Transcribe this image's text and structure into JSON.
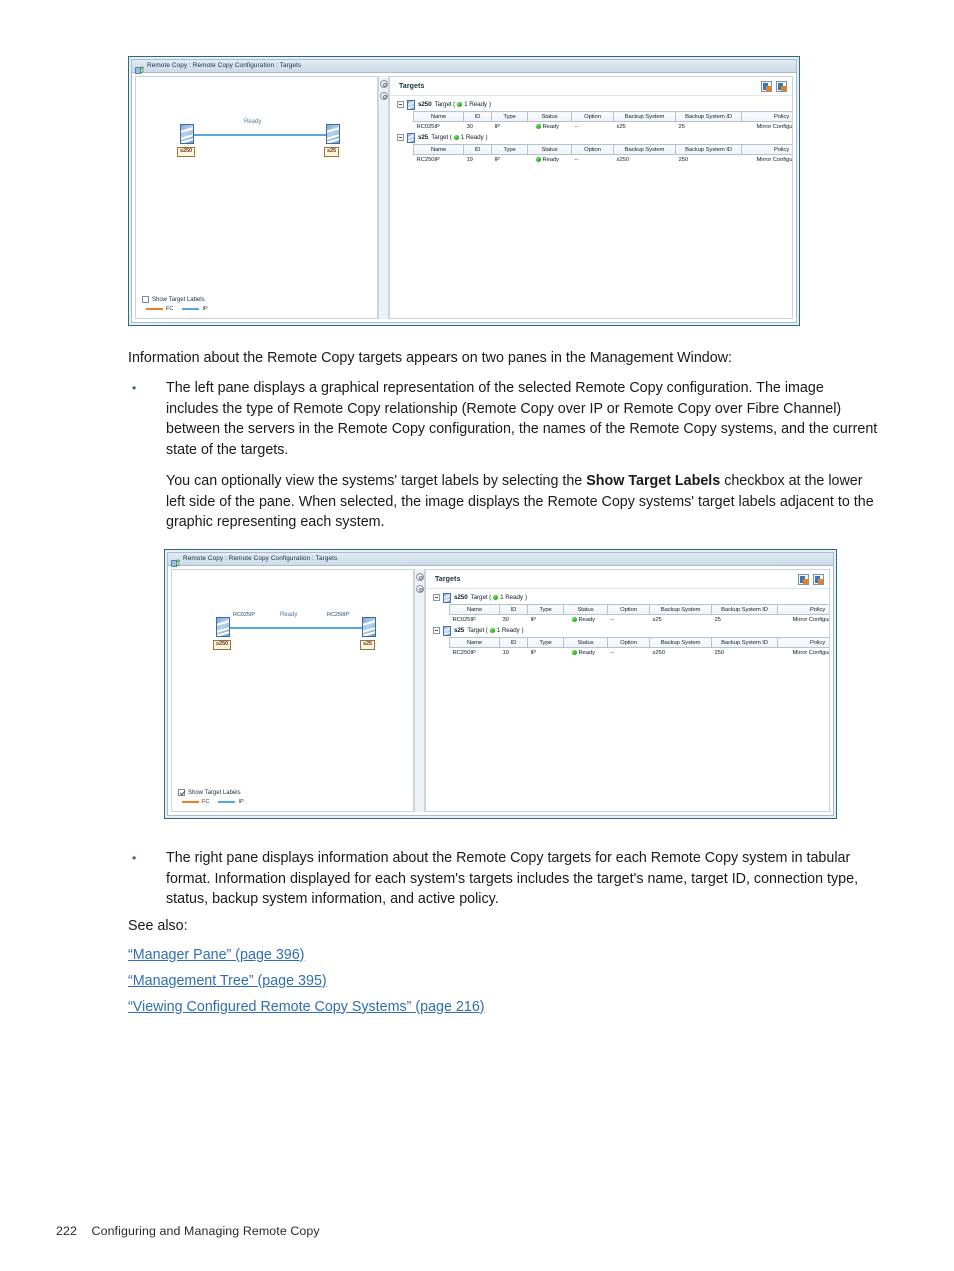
{
  "page": {
    "footer_page_number": "222",
    "footer_title": "Configuring and Managing Remote Copy"
  },
  "screenshot_top": {
    "window_title": "Remote Copy : Remote Copy Configuration : Targets",
    "window_icon": "remote-copy-icon",
    "diagram": {
      "left_system_label": "s250",
      "right_system_label": "s25",
      "link_state": "Ready",
      "link_type": "IP",
      "show_target_labels_checked": false,
      "left_target_label": "",
      "right_target_label": ""
    },
    "legend": {
      "checkbox_label": "Show Target Labels",
      "fc_label": "FC",
      "ip_label": "IP",
      "fc_color": "#ef7d20",
      "ip_color": "#55a7e0"
    },
    "right_pane": {
      "title": "Targets",
      "toolbar_icons": [
        "export-table-icon",
        "print-table-icon"
      ],
      "columns": [
        "Name",
        "ID",
        "Type",
        "Status",
        "Option",
        "Backup System",
        "Backup System ID",
        "Policy"
      ],
      "groups": [
        {
          "system": "s250",
          "node_suffix": "Target (",
          "node_count": "1 Ready",
          "node_suffix_end": ")",
          "rows": [
            {
              "name": "RC025IP",
              "id": "30",
              "type": "IP",
              "status": "Ready",
              "option": "--",
              "backup_system": "s25",
              "backup_system_id": "25",
              "policy": "Mirror Configuration"
            }
          ]
        },
        {
          "system": "s25",
          "node_suffix": "Target (",
          "node_count": "1 Ready",
          "node_suffix_end": ")",
          "rows": [
            {
              "name": "RC250IP",
              "id": "19",
              "type": "IP",
              "status": "Ready",
              "option": "--",
              "backup_system": "s250",
              "backup_system_id": "250",
              "policy": "Mirror Configuration"
            }
          ]
        }
      ]
    }
  },
  "screenshot_bottom": {
    "window_title": "Remote Copy : Remote Copy Configuration : Targets",
    "window_icon": "remote-copy-icon",
    "diagram": {
      "left_system_label": "s250",
      "right_system_label": "s25",
      "link_state": "Ready",
      "link_type": "IP",
      "show_target_labels_checked": true,
      "left_target_label": "RC025IP",
      "right_target_label": "RC250IP"
    },
    "legend": {
      "checkbox_label": "Show Target Labels",
      "fc_label": "FC",
      "ip_label": "IP",
      "fc_color": "#ef7d20",
      "ip_color": "#55a7e0"
    },
    "right_pane": {
      "title": "Targets",
      "toolbar_icons": [
        "export-table-icon",
        "print-table-icon"
      ],
      "columns": [
        "Name",
        "ID",
        "Type",
        "Status",
        "Option",
        "Backup System",
        "Backup System ID",
        "Policy"
      ],
      "groups": [
        {
          "system": "s250",
          "node_suffix": "Target (",
          "node_count": "1 Ready",
          "node_suffix_end": ")",
          "rows": [
            {
              "name": "RC025IP",
              "id": "30",
              "type": "IP",
              "status": "Ready",
              "option": "--",
              "backup_system": "s25",
              "backup_system_id": "25",
              "policy": "Mirror Configuration"
            }
          ]
        },
        {
          "system": "s25",
          "node_suffix": "Target (",
          "node_count": "1 Ready",
          "node_suffix_end": ")",
          "rows": [
            {
              "name": "RC250IP",
              "id": "19",
              "type": "IP",
              "status": "Ready",
              "option": "--",
              "backup_system": "s250",
              "backup_system_id": "250",
              "policy": "Mirror Configuration"
            }
          ]
        }
      ]
    }
  },
  "body": {
    "intro": "Information about the Remote Copy targets appears on two panes in the Management Window:",
    "bullet_marker": "•",
    "bullet1_text": "The left pane displays a graphical representation of the selected Remote Copy configuration. The image includes the type of Remote Copy relationship (Remote Copy over IP or Remote Copy over Fibre Channel) between the servers in the Remote Copy configuration, the names of the Remote Copy systems, and the current state of the targets.",
    "bullet1_note_before": "You can optionally view the systems' target labels by selecting the ",
    "bullet1_note_bold": "Show Target Labels",
    "bullet1_note_after": " checkbox at the lower left side of the pane. When selected, the image displays the Remote Copy systems' target labels adjacent to the graphic representing each system.",
    "bullet2_text": "The right pane displays information about the Remote Copy targets for each Remote Copy system in tabular format. Information displayed for each system's targets includes the target's name, target ID, connection type, status, backup system information, and active policy.",
    "see_also_label": "See also:",
    "links": [
      "“Manager Pane” (page 396)",
      "“Management Tree” (page 395)",
      "“Viewing Configured Remote Copy Systems” (page 216)"
    ]
  }
}
